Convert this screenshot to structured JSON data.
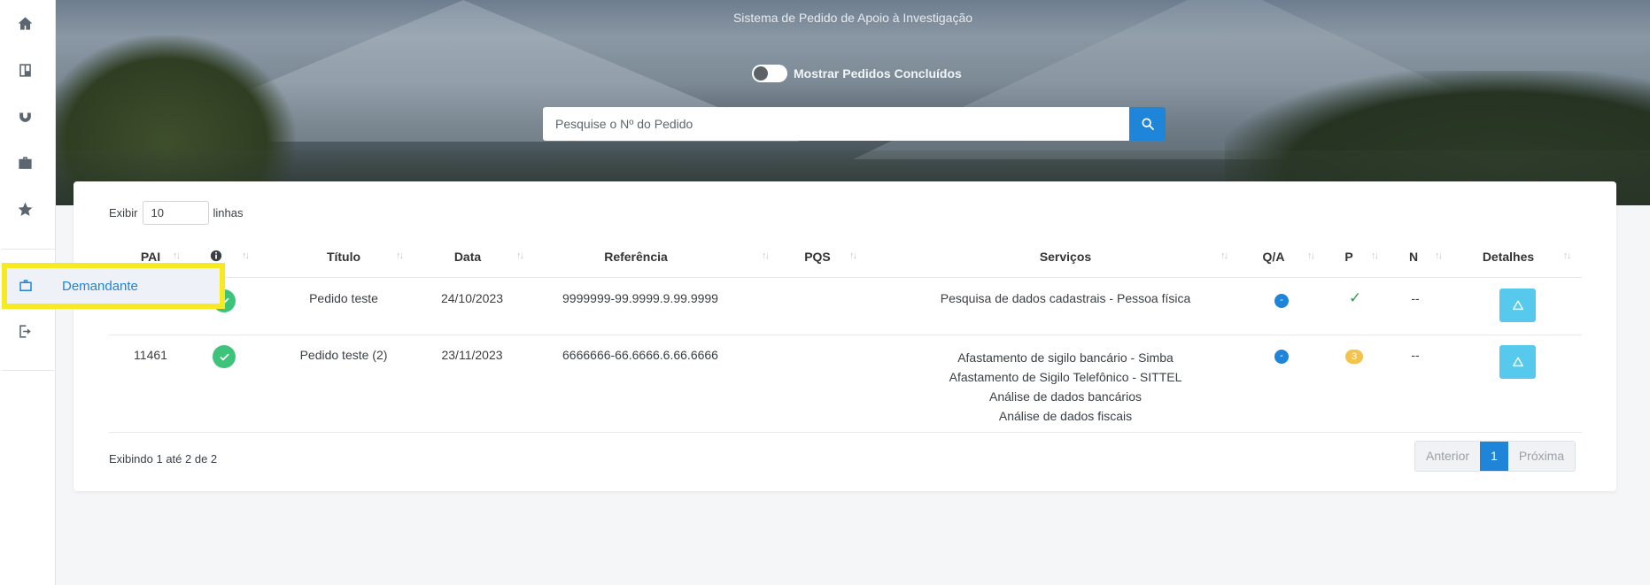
{
  "sidebar": {
    "icons": [
      "home-icon",
      "board-icon",
      "magnet-icon",
      "briefcase-icon",
      "star-icon",
      "logout-icon"
    ],
    "flyout_label": "Demandante"
  },
  "hero": {
    "subtitle": "Sistema de Pedido de Apoio à Investigação",
    "toggle_label": "Mostrar Pedidos Concluídos",
    "toggle_on": false,
    "search_placeholder": "Pesquise o Nº do Pedido"
  },
  "table": {
    "length_prefix": "Exibir",
    "length_value": "10",
    "length_suffix": "linhas",
    "columns": [
      "PAI",
      "",
      "Título",
      "Data",
      "Referência",
      "PQS",
      "Serviços",
      "Q/A",
      "P",
      "N",
      "Detalhes"
    ],
    "rows": [
      {
        "pai": "",
        "titulo": "Pedido teste",
        "data": "24/10/2023",
        "referencia": "9999999-99.9999.9.99.9999",
        "pqs": "",
        "servicos": [
          "Pesquisa de dados cadastrais - Pessoa física"
        ],
        "qa": "-",
        "p": "✓",
        "n": "--"
      },
      {
        "pai": "11461",
        "titulo": "Pedido teste (2)",
        "data": "23/11/2023",
        "referencia": "6666666-66.6666.6.66.6666",
        "pqs": "",
        "servicos": [
          "Afastamento de sigilo bancário - Simba",
          "Afastamento de Sigilo Telefônico - SITTEL",
          "Análise de dados bancários",
          "Análise de dados fiscais"
        ],
        "qa": "-",
        "p": "3",
        "n": "--"
      }
    ],
    "info": "Exibindo 1 até 2 de 2",
    "pager": {
      "prev": "Anterior",
      "current": "1",
      "next": "Próxima"
    }
  },
  "colors": {
    "primary": "#1f85d8",
    "success": "#3ec37a",
    "warning": "#f3c34b",
    "info": "#56c9ec",
    "highlight": "#f6ea23"
  }
}
